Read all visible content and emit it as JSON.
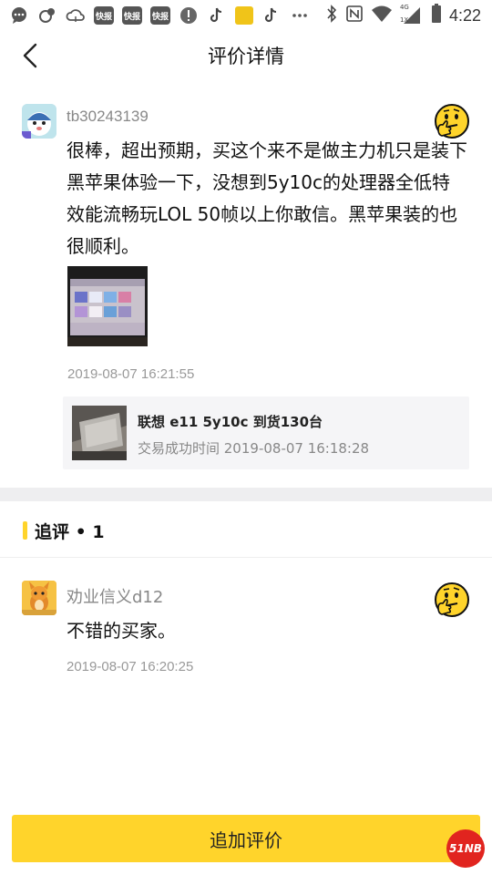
{
  "status_bar": {
    "app_tags": [
      "快报",
      "快报",
      "快报"
    ],
    "time": "4:22",
    "network_label": "4G",
    "network_sub": "1X"
  },
  "nav": {
    "title": "评价详情"
  },
  "review": {
    "username": "tb30243139",
    "text": "很棒，超出预期，买这个来不是做主力机只是装下黑苹果体验一下，没想到5y10c的处理器全低特效能流畅玩LOL 50帧以上你敢信。黑苹果装的也很顺利。",
    "time": "2019-08-07 16:21:55",
    "order": {
      "title": "联想 e11 5y10c 到货130台",
      "subtitle": "交易成功时间 2019-08-07 16:18:28"
    }
  },
  "followups": {
    "header": "追评 • 1",
    "items": [
      {
        "username": "劝业信义d12",
        "text": "不错的买家。",
        "time": "2019-08-07 16:20:25"
      }
    ]
  },
  "footer": {
    "add_button": "追加评价"
  },
  "watermark": "51NB",
  "colors": {
    "accent": "#ffd42b",
    "muted_text": "#888888",
    "card_bg": "#f5f5f7",
    "band_bg": "#eeeef0"
  }
}
